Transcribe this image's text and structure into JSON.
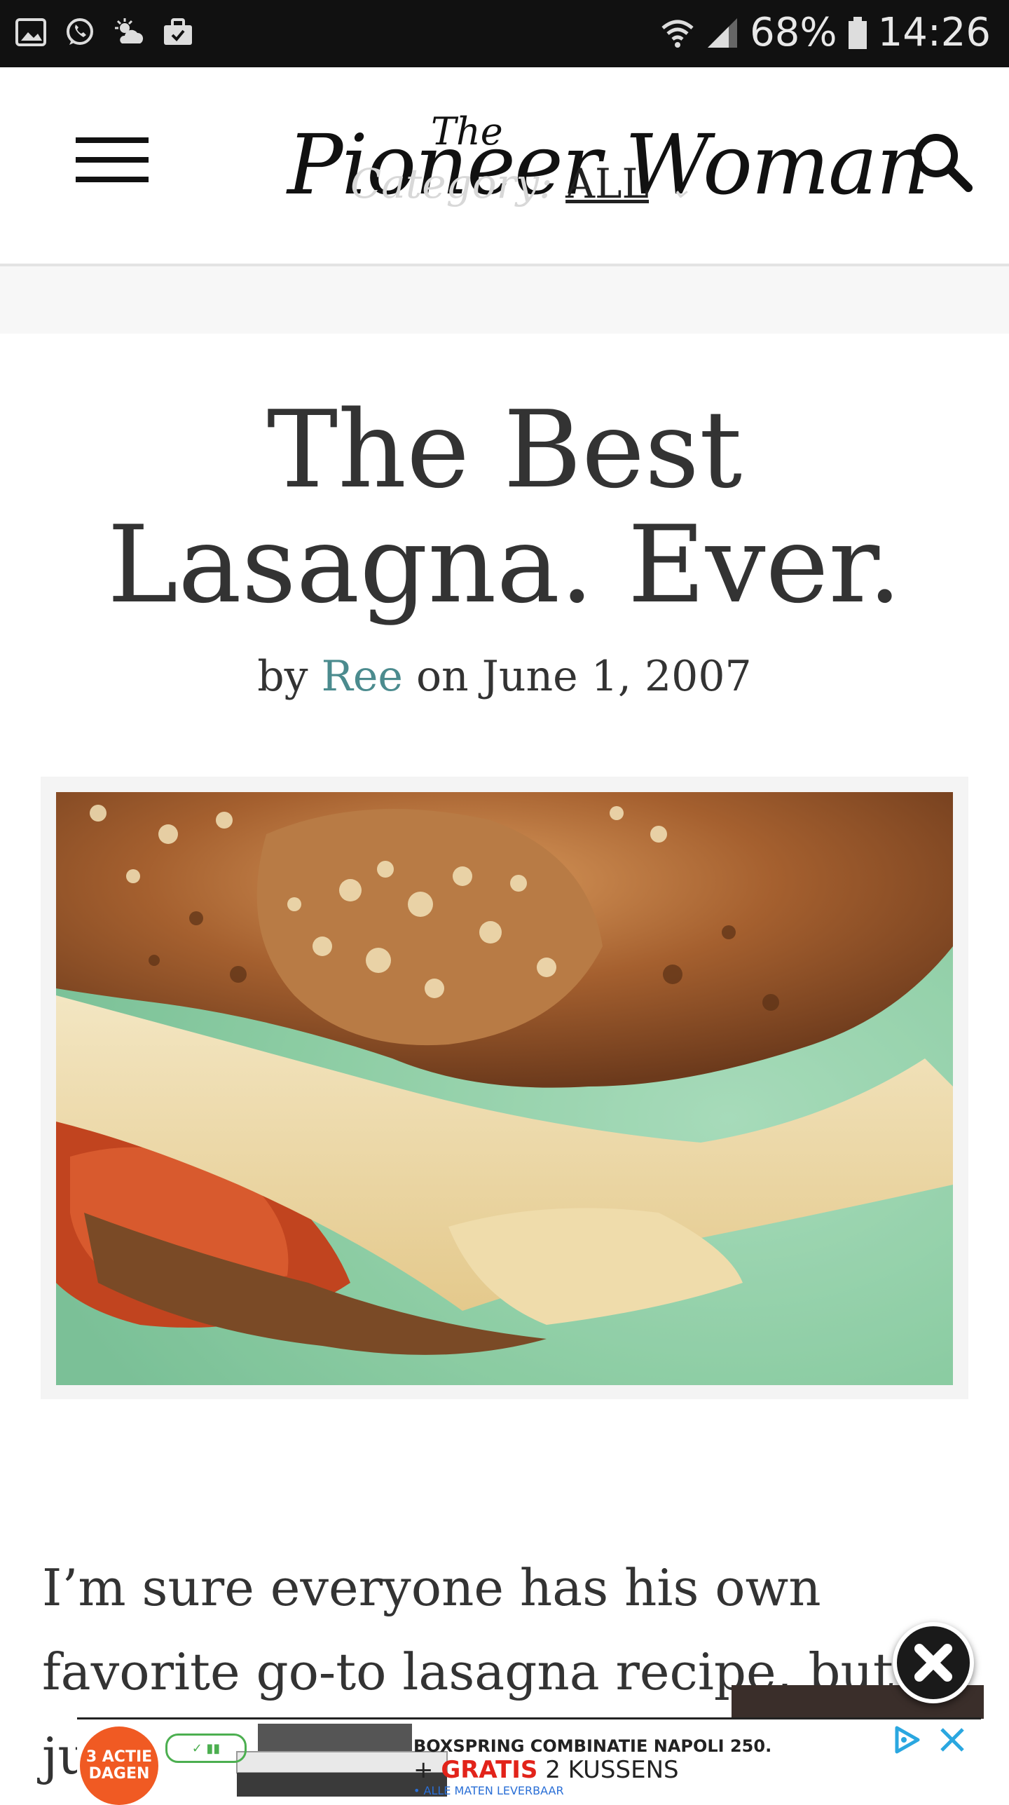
{
  "status_bar": {
    "battery": "68%",
    "time": "14:26",
    "icons": [
      "gallery-icon",
      "whatsapp-icon",
      "weather-icon",
      "briefcase-icon",
      "wifi-icon",
      "signal-icon",
      "battery-icon"
    ]
  },
  "header": {
    "logo_main": "Pioneer Woman",
    "logo_the": "The",
    "category_label": "Category:",
    "category_value": "ALL",
    "icons": [
      "menu-icon",
      "search-icon",
      "chevron-down-icon"
    ]
  },
  "article": {
    "title": "The Best Lasagna. Ever.",
    "by": "by",
    "author": "Ree",
    "on_date": "on June 1, 2007",
    "image_alt": "lasagna photo",
    "body_line1": "I’m sure everyone has his own",
    "body_line2": "favorite go-to lasagna recipe, but I’",
    "body_line3": "ju"
  },
  "ad": {
    "badge_line1": "3 ACTIE",
    "badge_line2": "DAGEN",
    "headline": "BOXSPRING COMBINATIE NAPOLI 250.",
    "plus": "+",
    "gratis": "GRATIS",
    "offer": "2 KUSSENS",
    "small": "• ALLE MATEN LEVERBAAR",
    "icons": [
      "adchoices-icon",
      "close-icon"
    ]
  },
  "colors": {
    "accent_link": "#4b8b8e",
    "status_bar_bg": "#111111",
    "ad_red": "#e2231a",
    "ad_badge": "#f05a23"
  }
}
